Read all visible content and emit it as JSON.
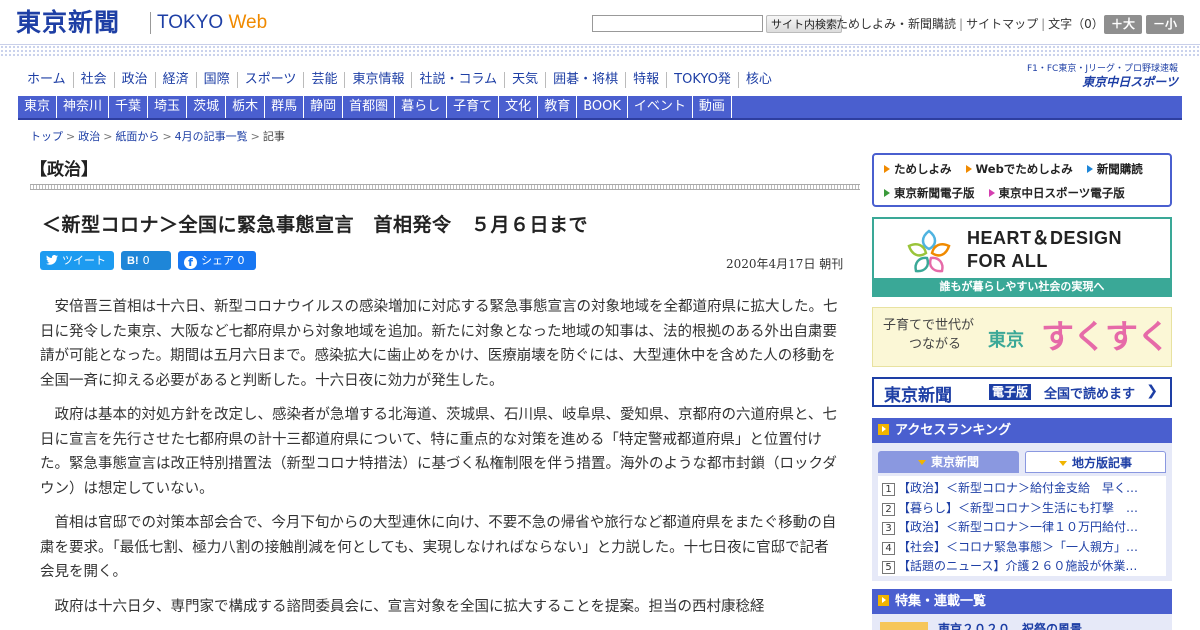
{
  "header": {
    "logo": "東京新聞",
    "logo_sub_prefix": "TOKYO ",
    "logo_sub_accent": "Web",
    "search_button": "サイト内検索",
    "links": [
      "ためしよみ・新聞購読",
      "サイトマップ"
    ],
    "font_size_label": "文字（0）",
    "size_up": "＋大",
    "size_down": "－小"
  },
  "main_nav": [
    "ホーム",
    "社会",
    "政治",
    "経済",
    "国際",
    "スポーツ",
    "芸能",
    "東京情報",
    "社説・コラム",
    "天気",
    "囲碁・将棋",
    "特報",
    "TOKYO発",
    "核心"
  ],
  "chunichi": {
    "line1": "F1・FC東京・Jリーグ・プロ野球速報",
    "line2": "東京中日スポーツ"
  },
  "sub_nav": [
    "東京",
    "神奈川",
    "千葉",
    "埼玉",
    "茨城",
    "栃木",
    "群馬",
    "静岡",
    "首都圏",
    "暮らし",
    "子育て",
    "文化",
    "教育",
    "BOOK",
    "イベント",
    "動画"
  ],
  "breadcrumb": [
    "トップ",
    "政治",
    "紙面から",
    "4月の記事一覧",
    "記事"
  ],
  "category": "【政治】",
  "article": {
    "title": "＜新型コロナ＞全国に緊急事態宣言　首相発令　５月６日まで",
    "date": "2020年4月17日 朝刊",
    "share": {
      "tweet": "ツイート",
      "hatena_icon": "B!",
      "hatena_count": "0",
      "fb_label": "シェア",
      "fb_count": "0"
    },
    "paragraphs": [
      "安倍晋三首相は十六日、新型コロナウイルスの感染増加に対応する緊急事態宣言の対象地域を全都道府県に拡大した。七日に発令した東京、大阪など七都府県から対象地域を追加。新たに対象となった地域の知事は、法的根拠のある外出自粛要請が可能となった。期間は五月六日まで。感染拡大に歯止めをかけ、医療崩壊を防ぐには、大型連休中を含めた人の移動を全国一斉に抑える必要があると判断した。十六日夜に効力が発生した。",
      "政府は基本的対処方針を改定し、感染者が急増する北海道、茨城県、石川県、岐阜県、愛知県、京都府の六道府県と、七日に宣言を先行させた七都府県の計十三都道府県について、特に重点的な対策を進める「特定警戒都道府県」と位置付けた。緊急事態宣言は改正特別措置法（新型コロナ特措法）に基づく私権制限を伴う措置。海外のような都市封鎖（ロックダウン）は想定していない。",
      "首相は官邸での対策本部会合で、今月下旬からの大型連休に向け、不要不急の帰省や旅行など都道府県をまたぐ移動の自粛を要求。「最低七割、極力八割の接触削減を何としても、実現しなければならない」と力説した。十七日夜に官邸で記者会見を開く。",
      "政府は十六日夕、専門家で構成する諮問委員会に、宣言対象を全国に拡大することを提案。担当の西村康稔経"
    ]
  },
  "sidebar": {
    "quick_links": [
      "ためしよみ",
      "Webでためしよみ",
      "新聞購読",
      "東京新聞電子版",
      "東京中日スポーツ電子版"
    ],
    "hd_banner": {
      "line1": "HEART＆DESIGN",
      "line2": "FOR ALL",
      "footer": "誰もが暮らしやすい社会の実現へ"
    },
    "suku_banner": {
      "sub1": "子育てで世代が",
      "sub2": "つながる",
      "title1": "東京",
      "title2": "すくすく"
    },
    "denshi_banner": {
      "logo": "東京新聞",
      "tag": "電子版",
      "text": "全国で読めます",
      "arrow": "❯"
    },
    "ranking": {
      "title": "アクセスランキング",
      "tab_active": "東京新聞",
      "tab_other": "地方版記事",
      "items": [
        {
          "num": "1",
          "text": "【政治】＜新型コロナ＞給付金支給　早く…"
        },
        {
          "num": "2",
          "text": "【暮らし】＜新型コロナ＞生活にも打撃　…"
        },
        {
          "num": "3",
          "text": "【政治】＜新型コロナ＞一律１０万円給付…"
        },
        {
          "num": "4",
          "text": "【社会】＜コロナ緊急事態＞「一人親方」…"
        },
        {
          "num": "5",
          "text": "【話題のニュース】介護２６０施設が休業…"
        }
      ]
    },
    "features": {
      "title": "特集・連載一覧",
      "peek_text": "東京２０２０　祝祭の風景"
    }
  }
}
